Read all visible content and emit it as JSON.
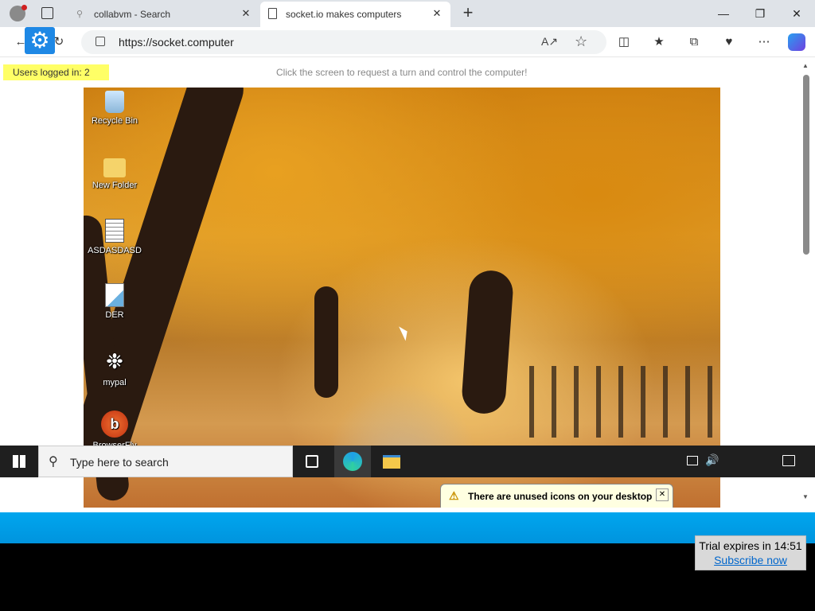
{
  "browser": {
    "tabs": [
      {
        "title": "collabvm - Search"
      },
      {
        "title": "socket.io makes computers"
      }
    ],
    "url": "https://socket.computer"
  },
  "page": {
    "users_logged_in": "Users logged in: 2",
    "hint": "Click the screen to request a turn and control the computer!"
  },
  "vm": {
    "desktop_icons": [
      {
        "label": "Recycle Bin",
        "icon": "recycle-bin-icon"
      },
      {
        "label": "New Folder",
        "icon": "folder-icon"
      },
      {
        "label": "ASDASDASD",
        "icon": "document-icon"
      },
      {
        "label": "DER",
        "icon": "file-icon"
      },
      {
        "label": "mypal",
        "icon": "mypal-icon"
      },
      {
        "label": "BrowserFly",
        "icon": "browser-icon"
      }
    ],
    "taskbar": {
      "search_placeholder": "Type here to search"
    },
    "notification": "There are unused icons on your desktop"
  },
  "trial": {
    "text": "Trial expires in 14:51",
    "link": "Subscribe now"
  },
  "colors": {
    "accent": "#00a6ee",
    "badge": "#ffff66"
  }
}
